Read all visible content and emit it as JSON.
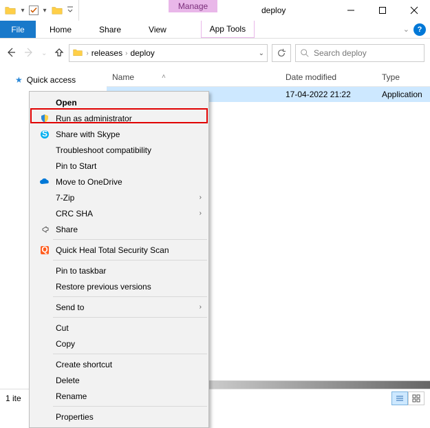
{
  "titlebar": {
    "manage": "Manage",
    "title": "deploy"
  },
  "ribbon": {
    "file": "File",
    "home": "Home",
    "share": "Share",
    "view": "View",
    "app_tools": "App Tools"
  },
  "nav": {
    "crumb1": "releases",
    "crumb2": "deploy"
  },
  "search": {
    "placeholder": "Search deploy"
  },
  "sidebar": {
    "quick_access": "Quick access"
  },
  "columns": {
    "name": "Name",
    "date": "Date modified",
    "type": "Type"
  },
  "row": {
    "date": "17-04-2022 21:22",
    "type": "Application"
  },
  "ctx": {
    "open": "Open",
    "run_admin": "Run as administrator",
    "share_skype": "Share with Skype",
    "troubleshoot": "Troubleshoot compatibility",
    "pin_start": "Pin to Start",
    "move_onedrive": "Move to OneDrive",
    "seven_zip": "7-Zip",
    "crc_sha": "CRC SHA",
    "share": "Share",
    "quick_heal": "Quick Heal Total Security Scan",
    "pin_taskbar": "Pin to taskbar",
    "restore_prev": "Restore previous versions",
    "send_to": "Send to",
    "cut": "Cut",
    "copy": "Copy",
    "create_shortcut": "Create shortcut",
    "delete": "Delete",
    "rename": "Rename",
    "properties": "Properties"
  },
  "status": {
    "items": "1 ite"
  }
}
